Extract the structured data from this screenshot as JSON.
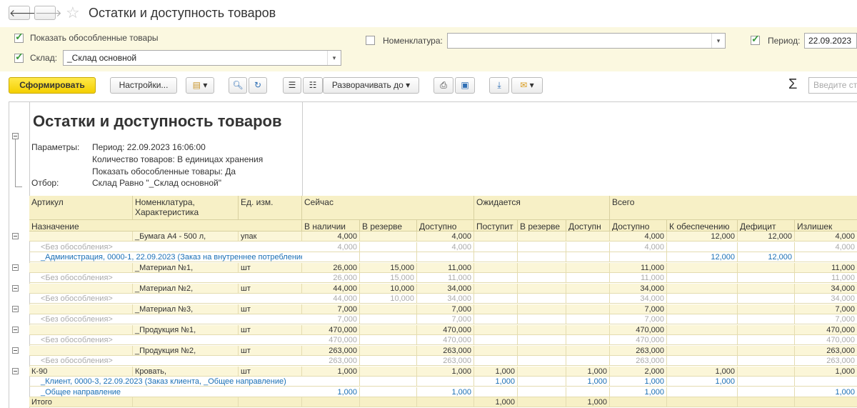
{
  "window": {
    "title": "Остатки и доступность товаров",
    "back": "🡐",
    "forward": "🡒"
  },
  "filters": {
    "show_separate_label": "Показать обособленные товары",
    "warehouse_label": "Склад:",
    "warehouse_value": "_Склад основной",
    "nomenclature_label": "Номенклатура:",
    "nomenclature_value": "",
    "period_label": "Период:",
    "period_value": "22.09.2023"
  },
  "toolbar": {
    "generate": "Сформировать",
    "settings": "Настройки...",
    "expand_to": "Разворачивать до",
    "search_placeholder": "Введите строку поиска",
    "sigma": "Σ"
  },
  "report": {
    "title": "Остатки и доступность товаров",
    "params_label": "Параметры:",
    "period": "Период: 22.09.2023 16:06:00",
    "qty": "Количество товаров: В единицах хранения",
    "show_separate": "Показать обособленные товары: Да",
    "filter_label": "Отбор:",
    "filter": "Склад Равно \"_Склад основной\""
  },
  "headers": {
    "article": "Артикул",
    "nomenclature": "Номенклатура, Характеристика",
    "unit": "Ед. изм.",
    "now": "Сейчас",
    "expected": "Ожидается",
    "total": "Всего",
    "purpose": "Назначение",
    "in_stock": "В наличии",
    "reserved": "В резерве",
    "available": "Доступно",
    "incoming": "Поступит",
    "exp_reserved": "В резерве",
    "exp_available": "Доступн",
    "tot_available": "Доступно",
    "to_provide": "К обеспечению",
    "deficit": "Дефицит",
    "surplus": "Излишек"
  },
  "rows": [
    {
      "type": "grp",
      "art": "",
      "name": "_Бумага А4 - 500 л,",
      "unit": "упак",
      "c": [
        "4,000",
        "",
        "4,000",
        "",
        "",
        "",
        "4,000",
        "12,000",
        "12,000",
        "4,000"
      ]
    },
    {
      "type": "sub",
      "art": "<Без обособления>",
      "name": "",
      "unit": "",
      "c": [
        "4,000",
        "",
        "4,000",
        "",
        "",
        "",
        "4,000",
        "",
        "",
        "4,000"
      ]
    },
    {
      "type": "blue",
      "art": "_Администрация, 0000-1, 22.09.2023 (Заказ на внутреннее потребление,",
      "name": "",
      "unit": "",
      "c": [
        "",
        "",
        "",
        "",
        "",
        "",
        "",
        "12,000",
        "12,000",
        ""
      ]
    },
    {
      "type": "grp",
      "art": "",
      "name": "_Материал №1,",
      "unit": "шт",
      "c": [
        "26,000",
        "15,000",
        "11,000",
        "",
        "",
        "",
        "11,000",
        "",
        "",
        "11,000"
      ]
    },
    {
      "type": "sub",
      "art": "<Без обособления>",
      "name": "",
      "unit": "",
      "c": [
        "26,000",
        "15,000",
        "11,000",
        "",
        "",
        "",
        "11,000",
        "",
        "",
        "11,000"
      ]
    },
    {
      "type": "grp",
      "art": "",
      "name": "_Материал №2,",
      "unit": "шт",
      "c": [
        "44,000",
        "10,000",
        "34,000",
        "",
        "",
        "",
        "34,000",
        "",
        "",
        "34,000"
      ]
    },
    {
      "type": "sub",
      "art": "<Без обособления>",
      "name": "",
      "unit": "",
      "c": [
        "44,000",
        "10,000",
        "34,000",
        "",
        "",
        "",
        "34,000",
        "",
        "",
        "34,000"
      ]
    },
    {
      "type": "grp",
      "art": "",
      "name": "_Материал №3,",
      "unit": "шт",
      "c": [
        "7,000",
        "",
        "7,000",
        "",
        "",
        "",
        "7,000",
        "",
        "",
        "7,000"
      ]
    },
    {
      "type": "sub",
      "art": "<Без обособления>",
      "name": "",
      "unit": "",
      "c": [
        "7,000",
        "",
        "7,000",
        "",
        "",
        "",
        "7,000",
        "",
        "",
        "7,000"
      ]
    },
    {
      "type": "grp",
      "art": "",
      "name": "_Продукция №1,",
      "unit": "шт",
      "c": [
        "470,000",
        "",
        "470,000",
        "",
        "",
        "",
        "470,000",
        "",
        "",
        "470,000"
      ]
    },
    {
      "type": "sub",
      "art": "<Без обособления>",
      "name": "",
      "unit": "",
      "c": [
        "470,000",
        "",
        "470,000",
        "",
        "",
        "",
        "470,000",
        "",
        "",
        "470,000"
      ]
    },
    {
      "type": "grp",
      "art": "",
      "name": "_Продукция №2,",
      "unit": "шт",
      "c": [
        "263,000",
        "",
        "263,000",
        "",
        "",
        "",
        "263,000",
        "",
        "",
        "263,000"
      ]
    },
    {
      "type": "sub",
      "art": "<Без обособления>",
      "name": "",
      "unit": "",
      "c": [
        "263,000",
        "",
        "263,000",
        "",
        "",
        "",
        "263,000",
        "",
        "",
        "263,000"
      ]
    },
    {
      "type": "grp",
      "art": "К-90",
      "name": "Кровать,",
      "unit": "шт",
      "c": [
        "1,000",
        "",
        "1,000",
        "1,000",
        "",
        "1,000",
        "2,000",
        "1,000",
        "",
        "1,000"
      ]
    },
    {
      "type": "blue",
      "art": "_Клиент, 0000-3, 22.09.2023 (Заказ клиента, _Общее направление)",
      "name": "",
      "unit": "",
      "c": [
        "",
        "",
        "",
        "1,000",
        "",
        "1,000",
        "1,000",
        "1,000",
        "",
        ""
      ]
    },
    {
      "type": "blue",
      "art": "_Общее направление",
      "name": "",
      "unit": "",
      "c": [
        "1,000",
        "",
        "1,000",
        "",
        "",
        "",
        "1,000",
        "",
        "",
        "1,000"
      ]
    },
    {
      "type": "total",
      "art": "Итого",
      "name": "",
      "unit": "",
      "c": [
        "",
        "",
        "",
        "1,000",
        "",
        "1,000",
        "",
        "",
        "",
        ""
      ]
    }
  ]
}
